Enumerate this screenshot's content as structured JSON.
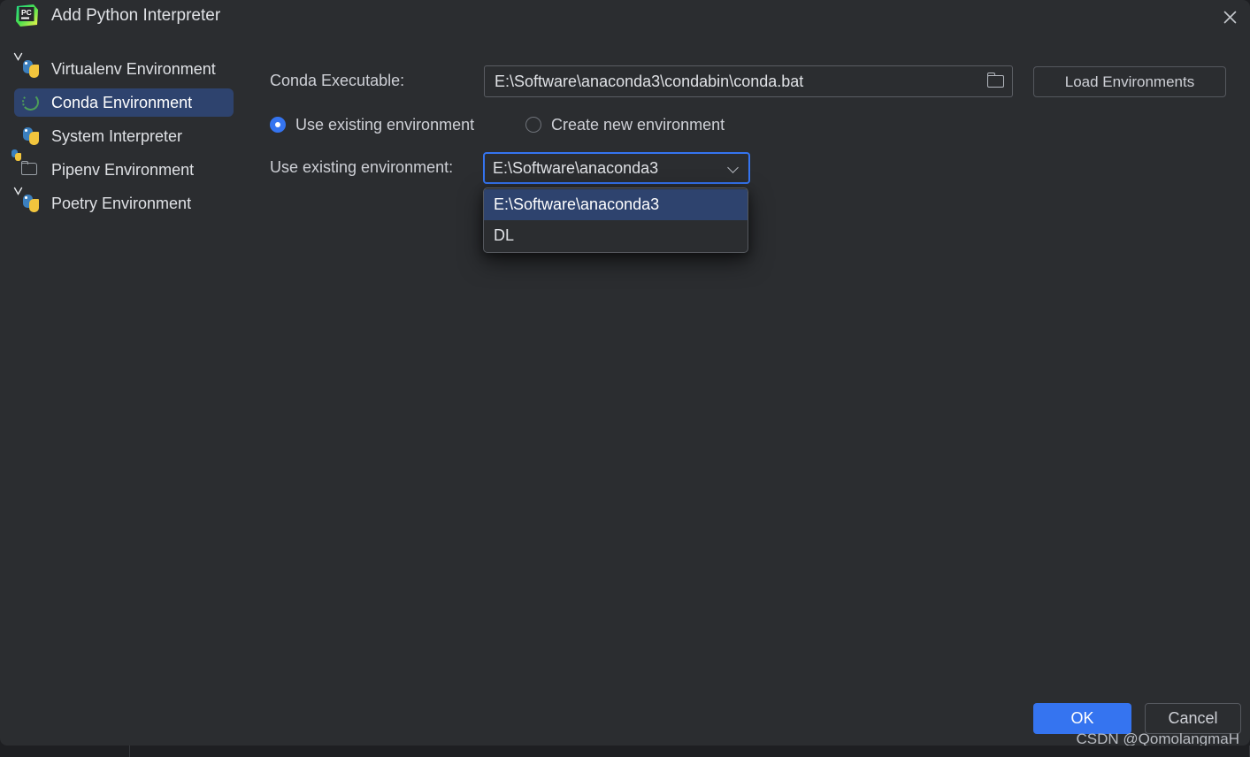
{
  "window": {
    "title": "Add Python Interpreter",
    "logo_icon": "pycharm-logo-icon",
    "logo_text": "PC",
    "close_icon": "close-icon"
  },
  "sidebar": {
    "items": [
      {
        "label": "Virtualenv Environment",
        "icon": "python-venv-icon",
        "selected": false
      },
      {
        "label": "Conda Environment",
        "icon": "conda-ring-icon",
        "selected": true
      },
      {
        "label": "System Interpreter",
        "icon": "python-icon",
        "selected": false
      },
      {
        "label": "Pipenv Environment",
        "icon": "folder-python-icon",
        "selected": false
      },
      {
        "label": "Poetry Environment",
        "icon": "python-venv-icon",
        "selected": false
      }
    ]
  },
  "form": {
    "conda_executable_label": "Conda Executable:",
    "conda_executable_value": "E:\\Software\\anaconda3\\condabin\\conda.bat",
    "browse_icon": "folder-icon",
    "load_environments_label": "Load Environments",
    "radios": [
      {
        "label": "Use existing environment",
        "selected": true
      },
      {
        "label": "Create new environment",
        "selected": false
      }
    ],
    "use_existing_label": "Use existing environment:",
    "environment_selected": "E:\\Software\\anaconda3",
    "dropdown_icon": "chevron-down-icon",
    "environment_options": [
      {
        "label": "E:\\Software\\anaconda3",
        "highlighted": true
      },
      {
        "label": "DL",
        "highlighted": false
      }
    ]
  },
  "footer": {
    "ok_label": "OK",
    "cancel_label": "Cancel"
  },
  "watermark": {
    "text": "CSDN @QomolangmaH"
  },
  "colors": {
    "dialog_bg": "#2b2d30",
    "accent_blue": "#3574f0",
    "selection_blue": "#2e436e",
    "text_primary": "#dfe1e5",
    "text_secondary": "#ced0d6",
    "border": "#55585e",
    "conda_green": "#4d9e58",
    "python_blue": "#3b7fbe",
    "python_yellow": "#f2c53d"
  }
}
